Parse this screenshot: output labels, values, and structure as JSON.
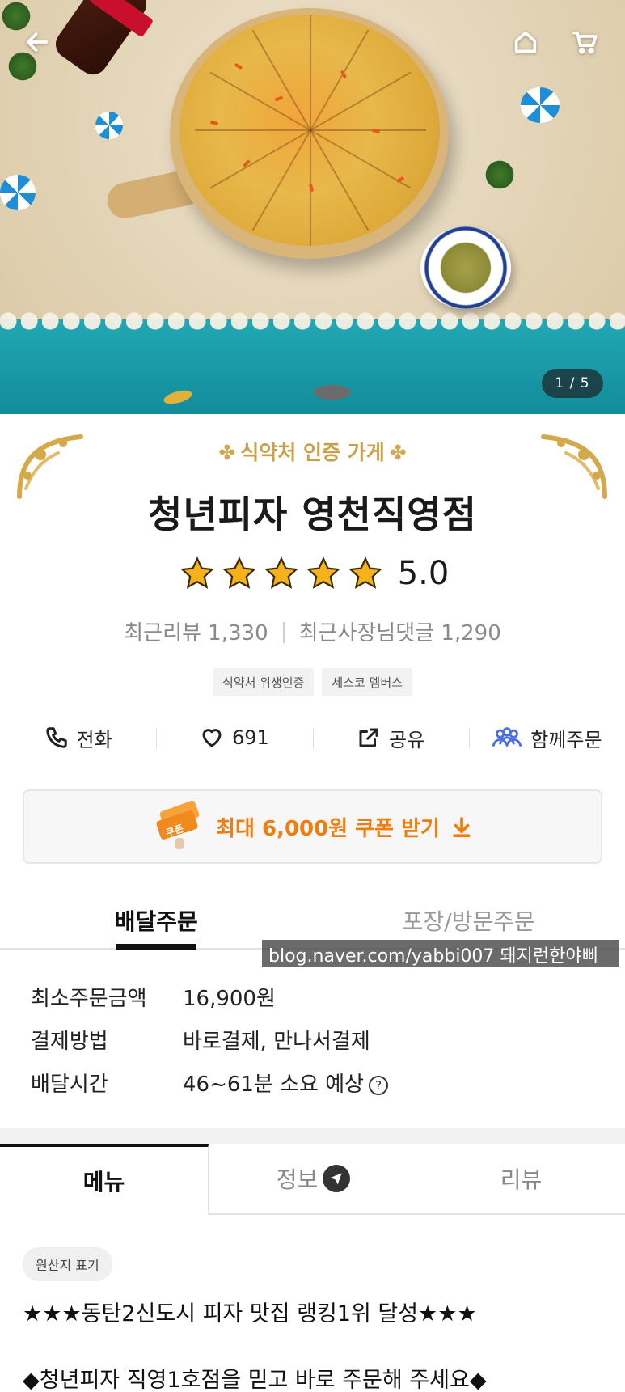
{
  "hero": {
    "pager": "1 / 5",
    "icons": {
      "back": "arrow-left-icon",
      "home": "home-icon",
      "cart": "cart-icon"
    }
  },
  "store": {
    "certification": "식약처 인증 가게",
    "name": "청년피자 영천직영점",
    "rating_value": "5.0",
    "stars": 5,
    "recent_review_label": "최근리뷰 1,330",
    "recent_owner_reply_label": "최근사장님댓글 1,290",
    "badges": [
      "식약처 위생인증",
      "세스코 멤버스"
    ]
  },
  "actions": {
    "call": "전화",
    "like": "691",
    "share": "공유",
    "together": "함께주문"
  },
  "coupon": {
    "icon_text": "쿠폰",
    "label": "최대 6,000원 쿠폰 받기"
  },
  "order_tabs": {
    "delivery": "배달주문",
    "pickup": "포장/방문주문"
  },
  "watermark": "blog.naver.com/yabbi007 돼지런한야삐",
  "order_info": {
    "min_order_label": "최소주문금액",
    "min_order_value": "16,900원",
    "payment_label": "결제방법",
    "payment_value": "바로결제, 만나서결제",
    "delivery_time_label": "배달시간",
    "delivery_time_value": "46~61분 소요 예상",
    "help": "?"
  },
  "menu_tabs": {
    "menu": "메뉴",
    "info": "정보",
    "review": "리뷰"
  },
  "menu": {
    "origin_chip": "원산지 표기",
    "notice_1": "★★★동탄2신도시 피자 맛집 랭킹1위 달성★★★",
    "notice_2": "◆청년피자 직영1호점을 믿고 바로 주문해 주세요◆"
  },
  "colors": {
    "accent_orange": "#f07d10",
    "gold": "#c9a04a",
    "together_blue": "#4a6fe3",
    "star": "#f5b21b"
  }
}
